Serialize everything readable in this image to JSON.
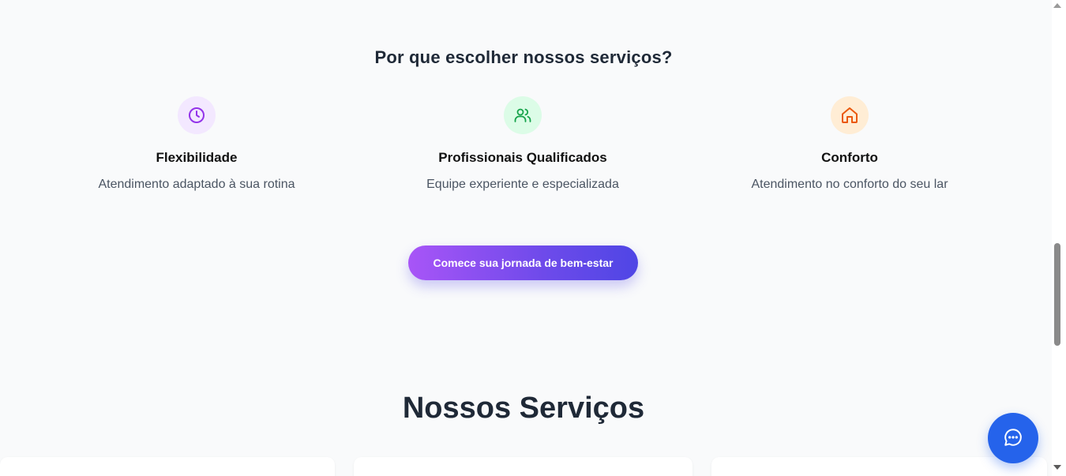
{
  "why_section": {
    "title": "Por que escolher nossos serviços?",
    "features": [
      {
        "icon": "clock-icon",
        "icon_color": "#9333ea",
        "icon_bg": "#f3e8ff",
        "title": "Flexibilidade",
        "description": "Atendimento adaptado à sua rotina"
      },
      {
        "icon": "users-icon",
        "icon_color": "#16a34a",
        "icon_bg": "#dcfce7",
        "title": "Profissionais Qualificados",
        "description": "Equipe experiente e especializada"
      },
      {
        "icon": "home-icon",
        "icon_color": "#ea580c",
        "icon_bg": "#ffedd5",
        "title": "Conforto",
        "description": "Atendimento no conforto do seu lar"
      }
    ],
    "cta_label": "Comece sua jornada de bem-estar"
  },
  "services_section": {
    "title": "Nossos Serviços"
  },
  "chat_widget": {
    "icon": "chat-bubble-icon",
    "color": "#2563eb"
  }
}
